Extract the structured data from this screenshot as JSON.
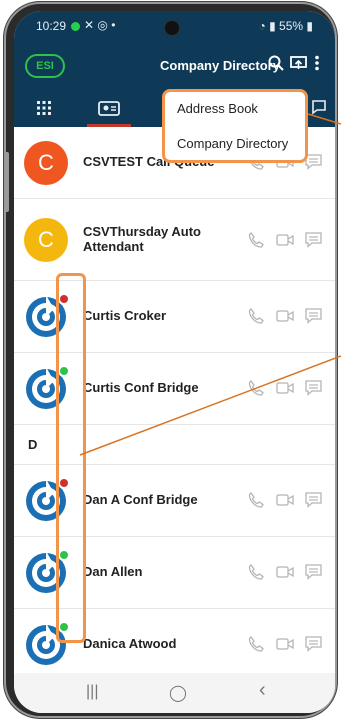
{
  "status": {
    "time": "10:29",
    "misc": "✕ ◎ •",
    "battery": "55%"
  },
  "header": {
    "badge": "ESI",
    "title": "Company Directory"
  },
  "menu": {
    "items": [
      "Address Book",
      "Company Directory"
    ]
  },
  "contacts": [
    {
      "name": "CSVTEST Call Queue",
      "avatar_letter": "C"
    },
    {
      "name": "CSVThursday Auto Attendant",
      "avatar_letter": "C"
    },
    {
      "name": "Curtis Croker"
    },
    {
      "name": "Curtis  Conf Bridge"
    },
    {
      "name": "Dan A Conf Bridge"
    },
    {
      "name": "Dan Allen"
    },
    {
      "name": "Danica Atwood"
    }
  ],
  "section_letter": "D",
  "nav": {
    "recents": "|||",
    "home": "◯",
    "back": "‹"
  },
  "colors": {
    "header_bg": "#0e3a57",
    "highlight": "#f2954a",
    "accent_red": "#c0392b",
    "presence_green": "#2fc24b"
  }
}
